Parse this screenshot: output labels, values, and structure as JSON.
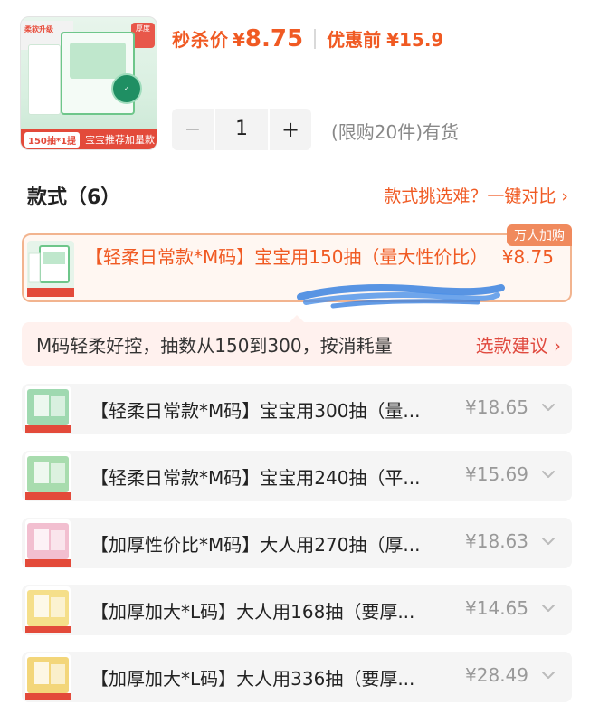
{
  "product": {
    "hero_pill": "150抽*1提",
    "hero_bar_text": "宝宝推荐加量款",
    "hero_top_tag": "柔软升级",
    "hero_badge": "厚度"
  },
  "pricing": {
    "flash_label": "秒杀价",
    "flash_currency": "¥",
    "flash_price": "8.75",
    "before_label": "优惠前",
    "before_price": "¥15.9"
  },
  "quantity": {
    "minus": "−",
    "value": "1",
    "plus": "+",
    "stock_text": "(限购20件)有货"
  },
  "section": {
    "title": "款式（6）",
    "compare_link": "款式挑选难？一键对比 ›"
  },
  "selected_option": {
    "label": "【轻柔日常款*M码】宝宝用150抽（量大性价比）",
    "price": "¥8.75",
    "tag": "万人加购"
  },
  "hint": {
    "text": "M码轻柔好控，抽数从150到300，按消耗量",
    "link": "选款建议 ›"
  },
  "options": [
    {
      "label": "【轻柔日常款*M码】宝宝用300抽（量...",
      "price": "¥18.65",
      "thumb_color": "#9fd9b0"
    },
    {
      "label": "【轻柔日常款*M码】宝宝用240抽（平...",
      "price": "¥15.69",
      "thumb_color": "#a8dcae"
    },
    {
      "label": "【加厚性价比*M码】大人用270抽（厚...",
      "price": "¥18.63",
      "thumb_color": "#f2bfd0"
    },
    {
      "label": "【加厚加大*L码】大人用168抽（要厚...",
      "price": "¥14.65",
      "thumb_color": "#f5df8a"
    },
    {
      "label": "【加厚加大*L码】大人用336抽（要厚...",
      "price": "¥28.49",
      "thumb_color": "#f3d67a"
    }
  ],
  "colors": {
    "accent": "#f05a23",
    "selected_border": "#f2b48f",
    "hint_bg": "#fff1ee",
    "item_bg": "#f5f5f5"
  }
}
